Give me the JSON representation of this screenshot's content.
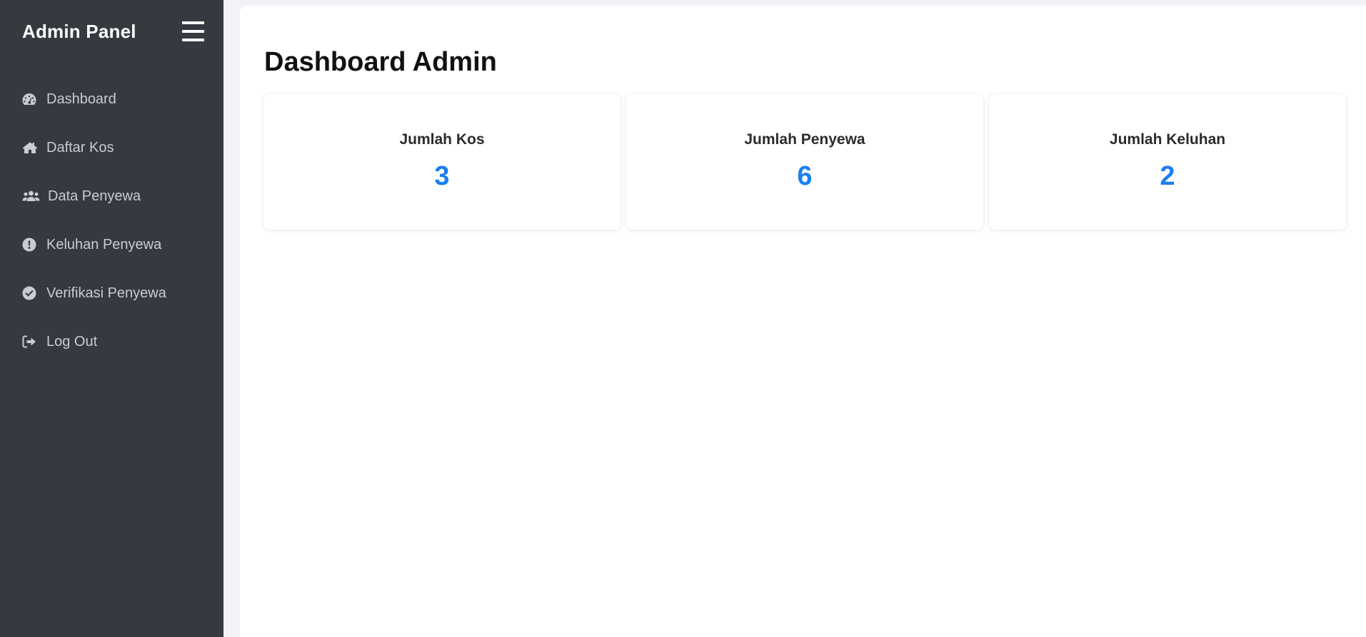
{
  "sidebar": {
    "brand": "Admin Panel",
    "items": [
      {
        "label": "Dashboard",
        "icon": "tachometer-icon"
      },
      {
        "label": "Daftar Kos",
        "icon": "home-icon"
      },
      {
        "label": "Data Penyewa",
        "icon": "users-icon"
      },
      {
        "label": "Keluhan Penyewa",
        "icon": "exclamation-circle-icon"
      },
      {
        "label": "Verifikasi Penyewa",
        "icon": "check-circle-icon"
      },
      {
        "label": "Log Out",
        "icon": "sign-out-icon"
      }
    ]
  },
  "main": {
    "title": "Dashboard Admin",
    "cards": [
      {
        "label": "Jumlah Kos",
        "value": "3"
      },
      {
        "label": "Jumlah Penyewa",
        "value": "6"
      },
      {
        "label": "Jumlah Keluhan",
        "value": "2"
      }
    ]
  },
  "colors": {
    "sidebar_bg": "#343a40",
    "accent": "#1a7ff0",
    "nav_text": "#c9ccd0"
  }
}
